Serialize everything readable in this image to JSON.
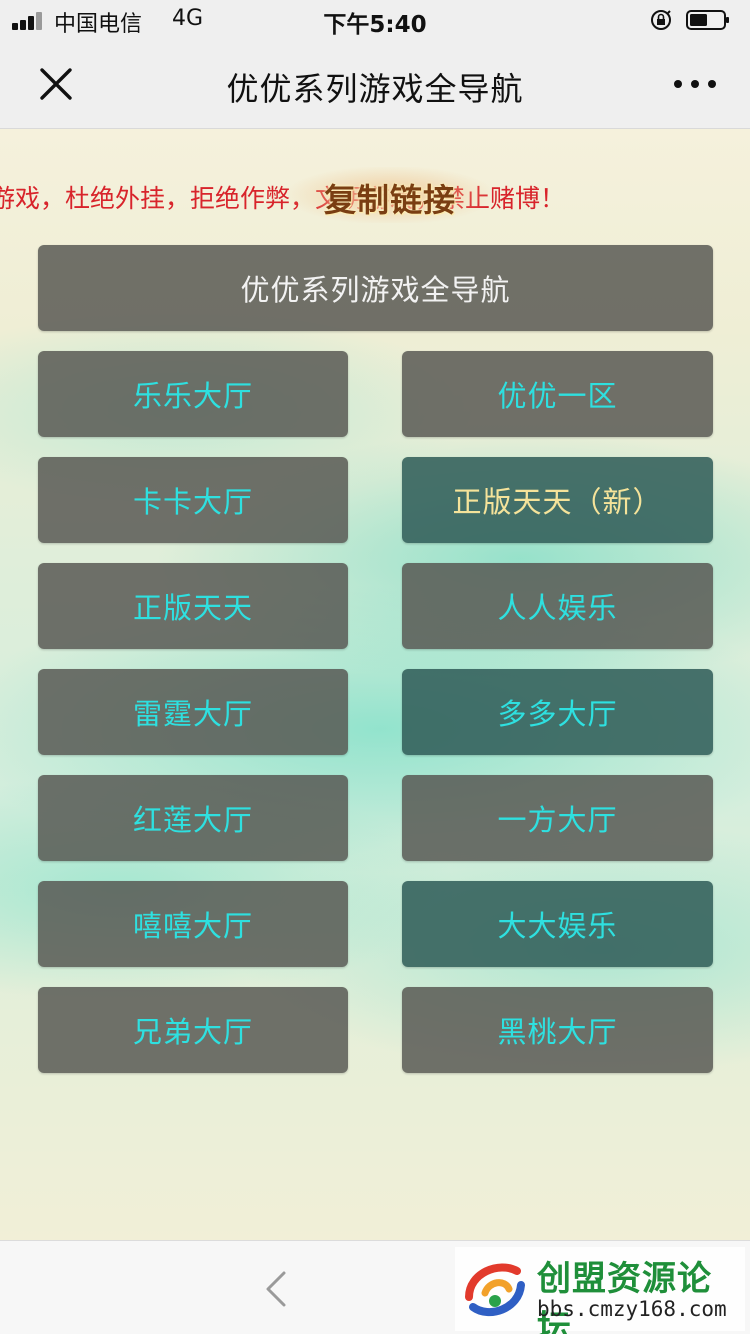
{
  "status_bar": {
    "carrier": "中国电信",
    "network": "4G",
    "time": "下午5:40"
  },
  "nav": {
    "title": "优优系列游戏全导航"
  },
  "page": {
    "marquee_text": "游戏，杜绝外挂，拒绝作弊，文明游戏，禁止赌博！",
    "copy_link_label": "复制链接",
    "header_button": "优优系列游戏全导航",
    "buttons": [
      {
        "label": "乐乐大厅",
        "style": "gray"
      },
      {
        "label": "优优一区",
        "style": "gray"
      },
      {
        "label": "卡卡大厅",
        "style": "gray"
      },
      {
        "label": "正版天天（新）",
        "style": "teal-gold"
      },
      {
        "label": "正版天天",
        "style": "gray"
      },
      {
        "label": "人人娱乐",
        "style": "gray"
      },
      {
        "label": "雷霆大厅",
        "style": "gray"
      },
      {
        "label": "多多大厅",
        "style": "teal"
      },
      {
        "label": "红莲大厅",
        "style": "gray"
      },
      {
        "label": "一方大厅",
        "style": "gray"
      },
      {
        "label": "嘻嘻大厅",
        "style": "gray"
      },
      {
        "label": "大大娱乐",
        "style": "teal"
      },
      {
        "label": "兄弟大厅",
        "style": "gray"
      },
      {
        "label": "黑桃大厅",
        "style": "gray"
      }
    ]
  },
  "watermark": {
    "name": "创盟资源论坛",
    "url": "bbs.cmzy168.com"
  },
  "icons": [
    "signal-icon",
    "lock-rotation-icon",
    "battery-icon",
    "close-icon",
    "more-icon",
    "back-arrow-icon",
    "forum-logo-icon"
  ]
}
